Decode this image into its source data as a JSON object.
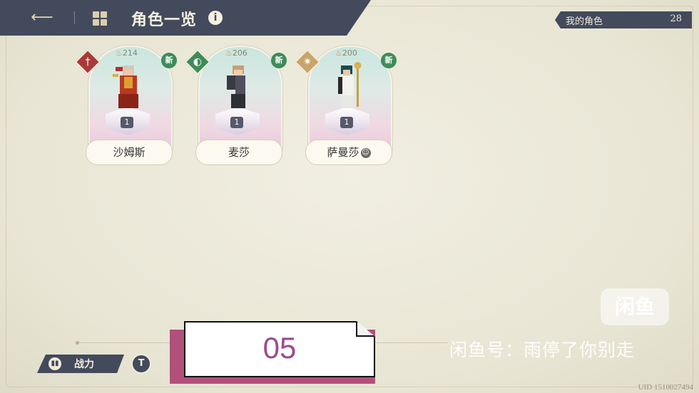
{
  "header": {
    "back_icon": "back-arrow-icon",
    "menu_icon": "grid-menu-icon",
    "title": "角色一览",
    "info_glyph": "i"
  },
  "my_characters": {
    "label": "我的角色",
    "count": "28"
  },
  "cards": [
    {
      "name": "沙姆斯",
      "power": "214",
      "level": "1",
      "new_label": "新",
      "element_color": "#a83a3a",
      "element_icon": "sword-icon"
    },
    {
      "name": "麦莎",
      "power": "206",
      "level": "1",
      "new_label": "新",
      "element_color": "#3f8c5a",
      "element_icon": "shield-icon"
    },
    {
      "name": "萨曼莎",
      "power": "200",
      "level": "1",
      "new_label": "新",
      "element_color": "#c9a46a",
      "element_icon": "sun-icon",
      "extra_glyph": "☺"
    }
  ],
  "bottom": {
    "sort_label": "战力",
    "filter_glyph": "T"
  },
  "overlay": {
    "number": "05",
    "watermark_logo": "闲鱼",
    "watermark_text": "闲鱼号：雨停了你别走",
    "uid": "UID 1510027494"
  },
  "colors": {
    "header": "#424a5c",
    "overlay_accent": "#b1507a",
    "number": "#9b4a8f"
  }
}
